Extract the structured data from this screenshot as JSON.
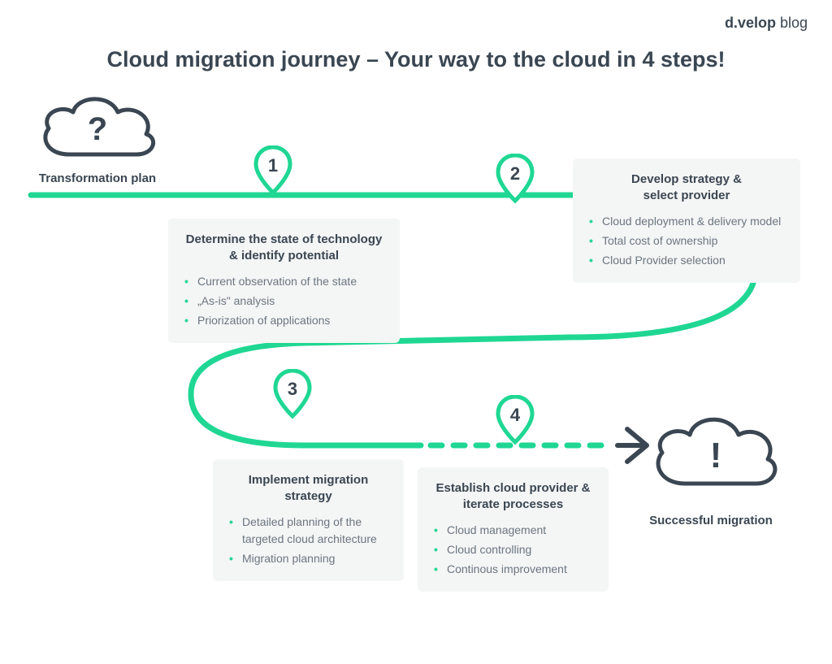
{
  "brand": {
    "strong": "d.velop",
    "light": " blog"
  },
  "title": "Cloud migration journey – Your way to the cloud in 4 steps!",
  "start_label": "Transformation plan",
  "end_label": "Successful migration",
  "start_symbol": "?",
  "end_symbol": "!",
  "markers": {
    "m1": "1",
    "m2": "2",
    "m3": "3",
    "m4": "4"
  },
  "cards": {
    "c1": {
      "title_line1": "Determine the state of technology",
      "title_line2": "& identify potential",
      "items": [
        "Current observation of the state",
        "„As-is\" analysis",
        "Priorization of applications"
      ]
    },
    "c2": {
      "title_line1": "Develop strategy &",
      "title_line2": "select provider",
      "items": [
        "Cloud deployment & delivery model",
        "Total cost of ownership",
        "Cloud Provider selection"
      ]
    },
    "c3": {
      "title_line1": "Implement migration",
      "title_line2": "strategy",
      "items": [
        "Detailed planning of the targeted cloud architecture",
        "Migration planning"
      ]
    },
    "c4": {
      "title_line1": "Establish cloud provider &",
      "title_line2": "iterate processes",
      "items": [
        "Cloud management",
        "Cloud controlling",
        "Continous improvement"
      ]
    }
  },
  "colors": {
    "accent": "#1fd793",
    "text_dark": "#3a4652",
    "text_muted": "#6b7680",
    "card_bg": "#f4f5f5"
  }
}
